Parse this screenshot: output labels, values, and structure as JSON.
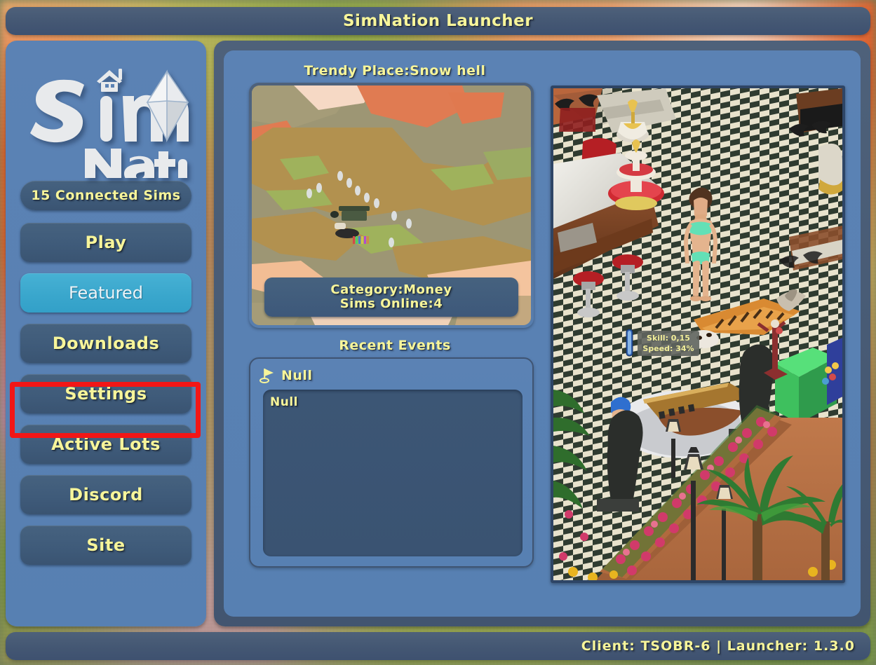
{
  "window": {
    "title": "SimNation Launcher"
  },
  "sidebar": {
    "logo": {
      "line1": "Sim",
      "line2": "Nation",
      "house_icon": "house-icon",
      "plumbob_icon": "plumbob-icon"
    },
    "status": {
      "label": "15 Connected Sims",
      "count": 15
    },
    "items": [
      {
        "label": "Play",
        "active": false
      },
      {
        "label": "Featured",
        "active": true
      },
      {
        "label": "Downloads",
        "active": false
      },
      {
        "label": "Settings",
        "active": false,
        "highlighted": true
      },
      {
        "label": "Active Lots",
        "active": false
      },
      {
        "label": "Discord",
        "active": false
      },
      {
        "label": "Site",
        "active": false
      }
    ]
  },
  "main": {
    "trendy": {
      "title": "Trendy Place:Snow hell",
      "place_name": "Snow hell",
      "category_line": "Category:Money",
      "category": "Money",
      "sims_online_line": "Sims Online:4",
      "sims_online": 4,
      "map_alt": "lot-map-thumbnail"
    },
    "events": {
      "title": "Recent Events",
      "flag_icon": "flag-icon",
      "headline": "Null",
      "body": "Null"
    },
    "screenshot": {
      "alt": "game-screenshot",
      "overlay": {
        "skill": "Skill: 0,15",
        "speed": "Speed: 34%"
      }
    }
  },
  "footer": {
    "text": "Client: TSOBR-6 | Launcher: 1.3.0",
    "client": "TSOBR-6",
    "launcher_version": "1.3.0"
  },
  "colors": {
    "accent_yellow": "#f7f59a",
    "panel_blue": "#5b82b4",
    "frame_slate": "#46587a",
    "button_dark": "#41607f",
    "active_cyan": "#3aa8ce",
    "highlight_red": "#f21616"
  }
}
